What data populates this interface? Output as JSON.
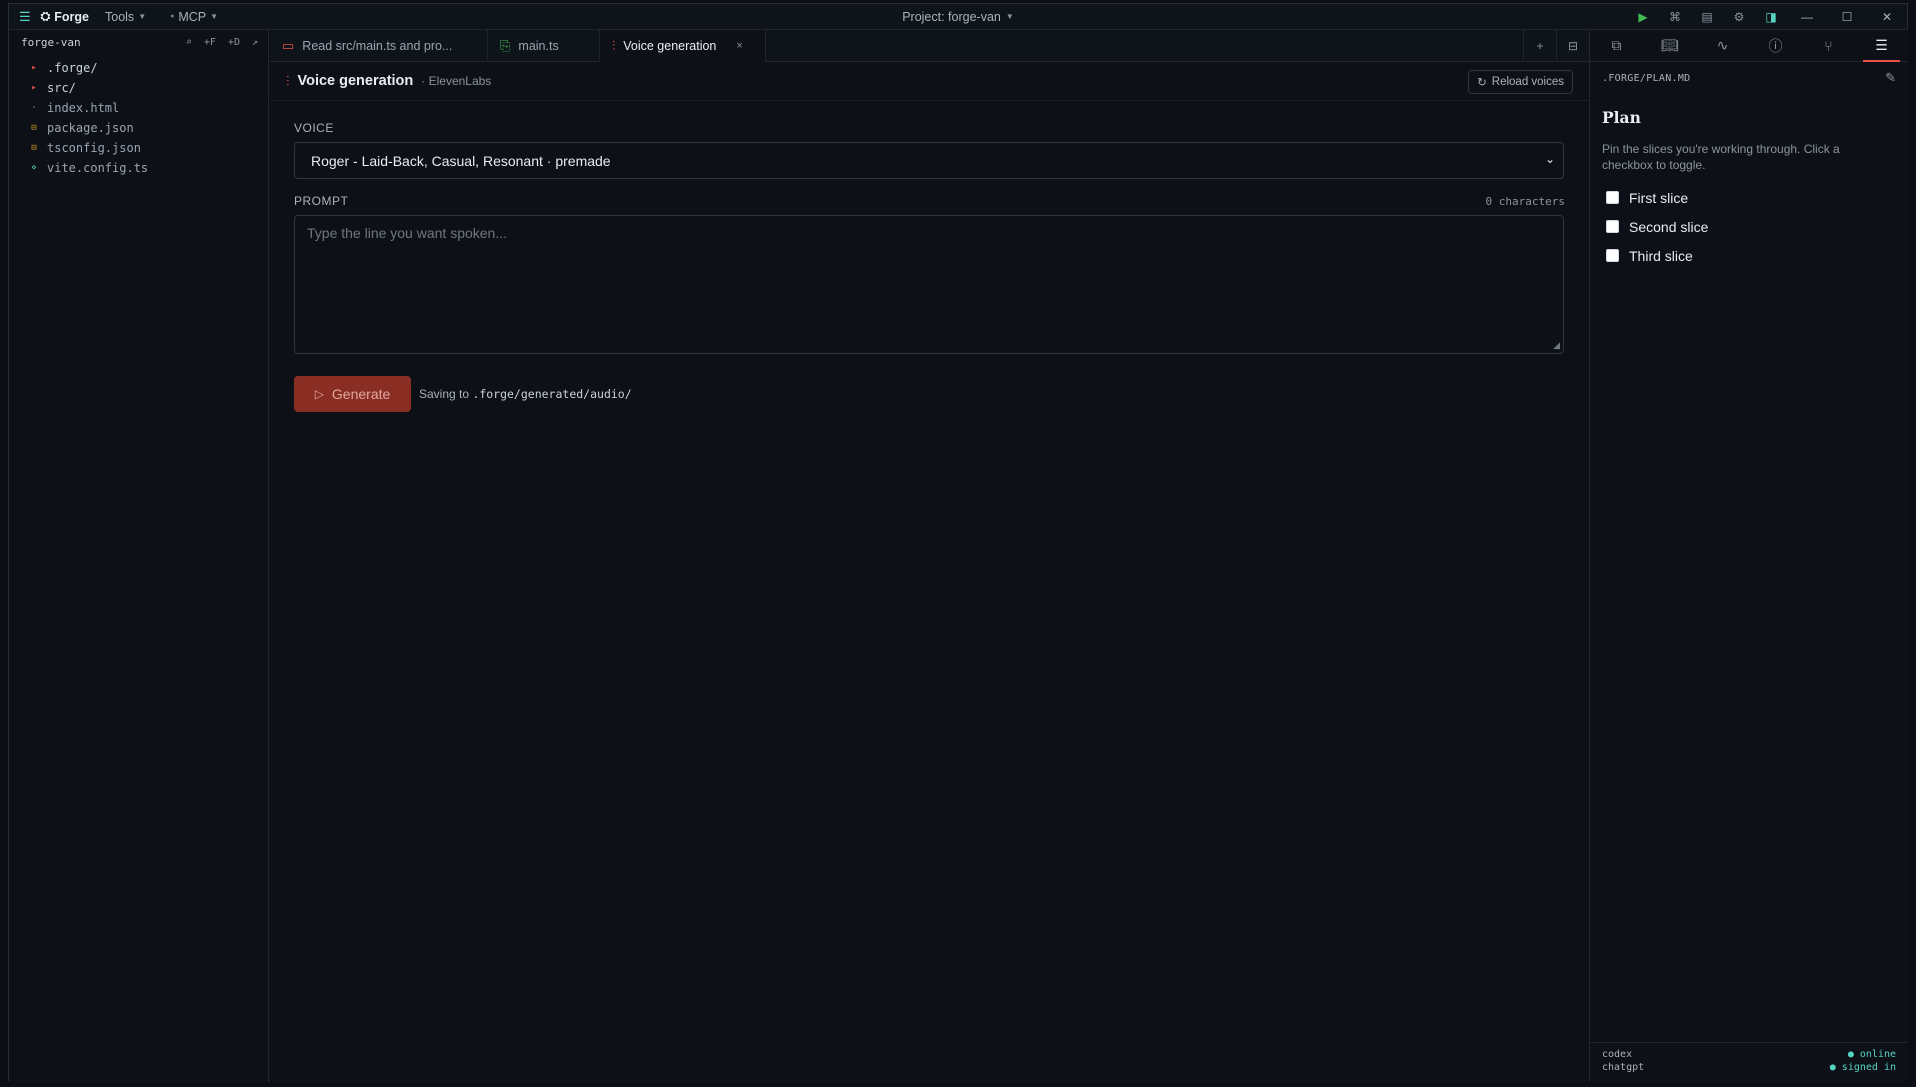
{
  "app": {
    "menu_icon": "hamburger-icon",
    "logo_icon": "forge-logo-icon",
    "name": "Forge",
    "menus": [
      "Tools",
      "MCP"
    ],
    "project_title": "Project: forge-van"
  },
  "titlebar_buttons": [
    "play-icon",
    "command-icon",
    "layout-icon",
    "gear-icon",
    "panel-icon"
  ],
  "sidebar": {
    "title": "forge-van",
    "actions": [
      "⌕",
      "+F",
      "+D",
      "↗"
    ],
    "items": [
      {
        "label": ".forge/",
        "type": "folder"
      },
      {
        "label": "src/",
        "type": "folder"
      },
      {
        "label": "index.html",
        "type": "html"
      },
      {
        "label": "package.json",
        "type": "json"
      },
      {
        "label": "tsconfig.json",
        "type": "json"
      },
      {
        "label": "vite.config.ts",
        "type": "ts"
      }
    ]
  },
  "tabs": [
    {
      "label": "Read src/main.ts and pro...",
      "icon": "chat-icon"
    },
    {
      "label": "main.ts",
      "icon": "file-code-icon"
    },
    {
      "label": "Voice generation",
      "icon": "waveform-icon",
      "active": true,
      "close": "×"
    }
  ],
  "panel": {
    "title": "Voice generation",
    "subtitle": "· ElevenLabs",
    "reload_label": "Reload voices",
    "voice_label": "VOICE",
    "voice_value": "Roger - Laid-Back, Casual, Resonant · premade",
    "prompt_label": "PROMPT",
    "char_count": "0 characters",
    "prompt_placeholder": "Type the line you want spoken...",
    "generate_label": "Generate",
    "saving_prefix": "Saving to",
    "saving_path": ".forge/generated/audio/"
  },
  "right_panel": {
    "tabs": [
      "chat-icon",
      "book-icon",
      "activity-icon",
      "info-icon",
      "git-branch-icon",
      "checklist-icon"
    ],
    "path": ".FORGE/PLAN.MD",
    "plan_title": "Plan",
    "plan_desc": "Pin the slices you're working through. Click a checkbox to toggle.",
    "slices": [
      "First slice",
      "Second slice",
      "Third slice"
    ],
    "footer": [
      {
        "name": "codex",
        "status": "● online"
      },
      {
        "name": "chatgpt",
        "status": "● signed in"
      }
    ]
  },
  "colors": {
    "accent": "#e5534b",
    "teal": "#56d4c4",
    "generate_button": "#8a2e24"
  }
}
